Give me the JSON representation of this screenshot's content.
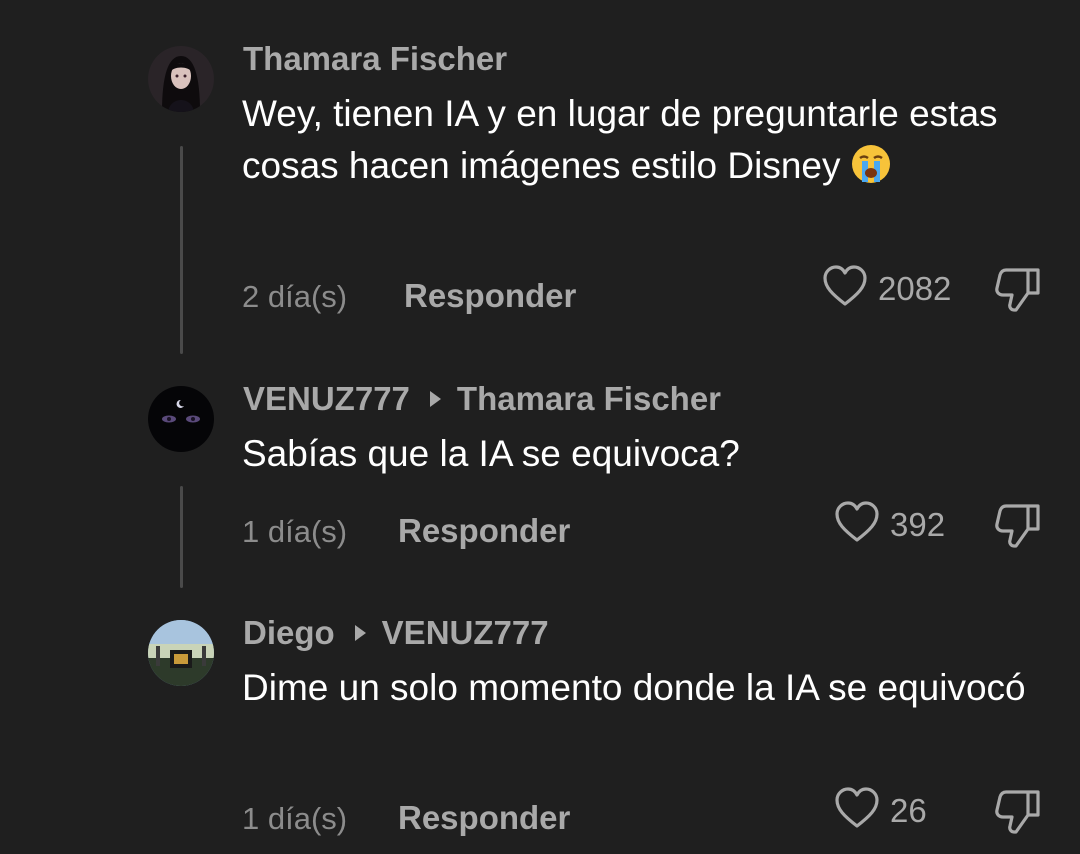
{
  "comments": [
    {
      "author": "Thamara Fischer",
      "reply_to": "",
      "text": "Wey, tienen IA y en lugar de preguntarle estas cosas hacen imágenes estilo Disney",
      "emoji": "crying-face",
      "time": "2 día(s)",
      "reply_label": "Responder",
      "likes": "2082"
    },
    {
      "author": "VENUZ777",
      "reply_to": "Thamara Fischer",
      "text": "Sabías que la IA se equivoca?",
      "time": "1 día(s)",
      "reply_label": "Responder",
      "likes": "392"
    },
    {
      "author": "Diego",
      "reply_to": "VENUZ777",
      "text": "Dime un solo momento donde la IA se equivocó",
      "time": "1 día(s)",
      "reply_label": "Responder",
      "likes": "26"
    }
  ],
  "colors": {
    "background": "#1f1f1f",
    "username": "#a9a9a9",
    "body": "#ffffff",
    "meta": "#8c8c8c"
  },
  "icons": [
    "heart-icon",
    "thumbs-down-icon",
    "reply-arrow-icon",
    "crying-face-emoji"
  ]
}
